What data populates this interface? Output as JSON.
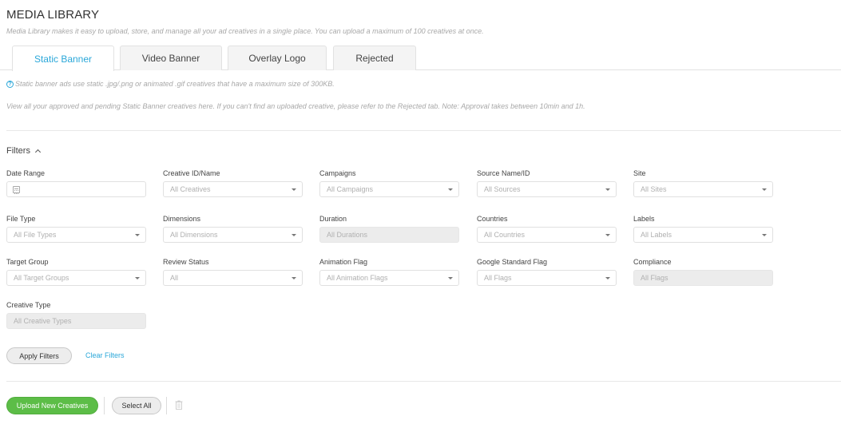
{
  "header": {
    "title": "MEDIA LIBRARY",
    "subtitle": "Media Library makes it easy to upload, store, and manage all your ad creatives in a single place. You can upload a maximum of 100 creatives at once."
  },
  "tabs": [
    {
      "label": "Static Banner",
      "active": true
    },
    {
      "label": "Video Banner",
      "active": false
    },
    {
      "label": "Overlay Logo",
      "active": false
    },
    {
      "label": "Rejected",
      "active": false
    }
  ],
  "info": {
    "icon": "help-circle-icon",
    "text": "Static banner ads use static .jpg/.png or animated .gif creatives that have a maximum size of 300KB.",
    "description": "View all your approved and pending Static Banner creatives here. If you can't find an uploaded creative, please refer to the Rejected tab. Note: Approval takes between 10min and 1h."
  },
  "filters": {
    "toggle_label": "Filters",
    "fields": {
      "date_range": {
        "label": "Date Range",
        "value": ""
      },
      "creative_id": {
        "label": "Creative ID/Name",
        "placeholder": "All Creatives"
      },
      "campaigns": {
        "label": "Campaigns",
        "placeholder": "All Campaigns"
      },
      "source": {
        "label": "Source Name/ID",
        "placeholder": "All Sources"
      },
      "site": {
        "label": "Site",
        "placeholder": "All Sites"
      },
      "file_type": {
        "label": "File Type",
        "placeholder": "All File Types"
      },
      "dimensions": {
        "label": "Dimensions",
        "placeholder": "All Dimensions"
      },
      "duration": {
        "label": "Duration",
        "placeholder": "All Durations"
      },
      "countries": {
        "label": "Countries",
        "placeholder": "All Countries"
      },
      "labels": {
        "label": "Labels",
        "placeholder": "All Labels"
      },
      "target_group": {
        "label": "Target Group",
        "placeholder": "All Target Groups"
      },
      "review_status": {
        "label": "Review Status",
        "placeholder": "All"
      },
      "animation_flag": {
        "label": "Animation Flag",
        "placeholder": "All Animation Flags"
      },
      "google_flag": {
        "label": "Google Standard Flag",
        "placeholder": "All Flags"
      },
      "compliance": {
        "label": "Compliance",
        "placeholder": "All Flags"
      },
      "creative_type": {
        "label": "Creative Type",
        "placeholder": "All Creative Types"
      }
    },
    "apply_label": "Apply Filters",
    "clear_label": "Clear Filters"
  },
  "actions": {
    "upload_label": "Upload New Creatives",
    "select_all_label": "Select All"
  },
  "colors": {
    "accent": "#2aa7d9",
    "upload_green": "#5cbd47"
  }
}
